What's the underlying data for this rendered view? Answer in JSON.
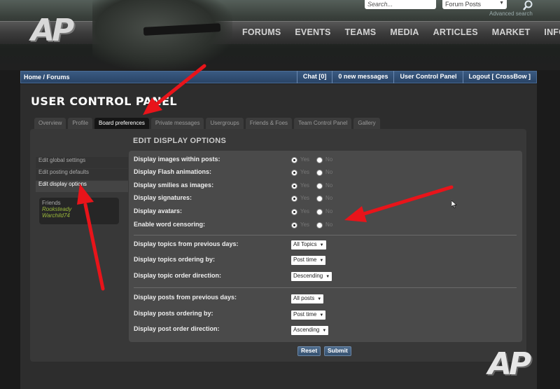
{
  "header": {
    "logo_text": "AP",
    "search_placeholder": "Search...",
    "search_scope": "Forum Posts",
    "advanced_search": "Advanced search",
    "nav": [
      "FORUMS",
      "EVENTS",
      "TEAMS",
      "MEDIA",
      "ARTICLES",
      "MARKET",
      "INFO"
    ]
  },
  "breadcrumb": {
    "path": "Home / Forums",
    "links": [
      "Chat [0]",
      "0 new messages",
      "User Control Panel",
      "Logout [ CrossBow ]"
    ]
  },
  "page": {
    "title": "USER CONTROL PANEL",
    "tabs": [
      "Overview",
      "Profile",
      "Board preferences",
      "Private messages",
      "Usergroups",
      "Friends & Foes",
      "Team Control Panel",
      "Gallery"
    ],
    "active_tab": "Board preferences"
  },
  "sidebar": {
    "items": [
      "Edit global settings",
      "Edit posting defaults",
      "Edit display options"
    ],
    "active_item": "Edit display options",
    "friends_title": "Friends",
    "friends": [
      "Rooksteady",
      "Warchild74"
    ]
  },
  "options": {
    "section_title": "EDIT DISPLAY OPTIONS",
    "yes_label": "Yes",
    "no_label": "No",
    "radio_rows": [
      {
        "label": "Display images within posts:",
        "value": "Yes"
      },
      {
        "label": "Display Flash animations:",
        "value": "Yes"
      },
      {
        "label": "Display smilies as images:",
        "value": "Yes"
      },
      {
        "label": "Display signatures:",
        "value": "Yes"
      },
      {
        "label": "Display avatars:",
        "value": "Yes"
      },
      {
        "label": "Enable word censoring:",
        "value": "Yes"
      }
    ],
    "topic_rows": [
      {
        "label": "Display topics from previous days:",
        "value": "All Topics"
      },
      {
        "label": "Display topics ordering by:",
        "value": "Post time"
      },
      {
        "label": "Display topic order direction:",
        "value": "Descending"
      }
    ],
    "post_rows": [
      {
        "label": "Display posts from previous days:",
        "value": "All posts"
      },
      {
        "label": "Display posts ordering by:",
        "value": "Post time"
      },
      {
        "label": "Display post order direction:",
        "value": "Ascending"
      }
    ]
  },
  "buttons": {
    "reset": "Reset",
    "submit": "Submit"
  },
  "watermark": "AP",
  "annotation_color": "#e8141a"
}
